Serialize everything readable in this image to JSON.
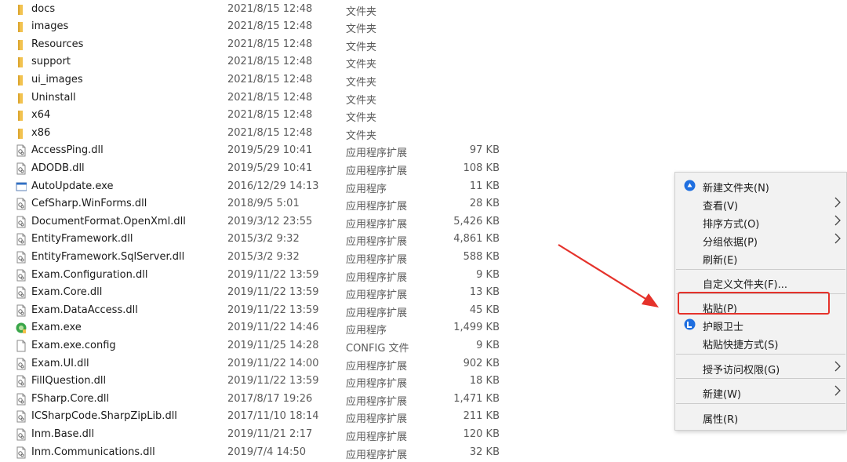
{
  "files": [
    {
      "name": "docs",
      "date": "2021/8/15 12:48",
      "type": "文件夹",
      "size": "",
      "icon": "folder-icon"
    },
    {
      "name": "images",
      "date": "2021/8/15 12:48",
      "type": "文件夹",
      "size": "",
      "icon": "folder-icon"
    },
    {
      "name": "Resources",
      "date": "2021/8/15 12:48",
      "type": "文件夹",
      "size": "",
      "icon": "folder-icon"
    },
    {
      "name": "support",
      "date": "2021/8/15 12:48",
      "type": "文件夹",
      "size": "",
      "icon": "folder-icon"
    },
    {
      "name": "ui_images",
      "date": "2021/8/15 12:48",
      "type": "文件夹",
      "size": "",
      "icon": "folder-icon"
    },
    {
      "name": "Uninstall",
      "date": "2021/8/15 12:48",
      "type": "文件夹",
      "size": "",
      "icon": "folder-icon"
    },
    {
      "name": "x64",
      "date": "2021/8/15 12:48",
      "type": "文件夹",
      "size": "",
      "icon": "folder-icon"
    },
    {
      "name": "x86",
      "date": "2021/8/15 12:48",
      "type": "文件夹",
      "size": "",
      "icon": "folder-icon"
    },
    {
      "name": "AccessPing.dll",
      "date": "2019/5/29 10:41",
      "type": "应用程序扩展",
      "size": "97 KB",
      "icon": "dll-icon"
    },
    {
      "name": "ADODB.dll",
      "date": "2019/5/29 10:41",
      "type": "应用程序扩展",
      "size": "108 KB",
      "icon": "dll-icon"
    },
    {
      "name": "AutoUpdate.exe",
      "date": "2016/12/29 14:13",
      "type": "应用程序",
      "size": "11 KB",
      "icon": "exe-icon"
    },
    {
      "name": "CefSharp.WinForms.dll",
      "date": "2018/9/5 5:01",
      "type": "应用程序扩展",
      "size": "28 KB",
      "icon": "dll-icon"
    },
    {
      "name": "DocumentFormat.OpenXml.dll",
      "date": "2019/3/12 23:55",
      "type": "应用程序扩展",
      "size": "5,426 KB",
      "icon": "dll-icon"
    },
    {
      "name": "EntityFramework.dll",
      "date": "2015/3/2 9:32",
      "type": "应用程序扩展",
      "size": "4,861 KB",
      "icon": "dll-icon"
    },
    {
      "name": "EntityFramework.SqlServer.dll",
      "date": "2015/3/2 9:32",
      "type": "应用程序扩展",
      "size": "588 KB",
      "icon": "dll-icon"
    },
    {
      "name": "Exam.Configuration.dll",
      "date": "2019/11/22 13:59",
      "type": "应用程序扩展",
      "size": "9 KB",
      "icon": "dll-icon"
    },
    {
      "name": "Exam.Core.dll",
      "date": "2019/11/22 13:59",
      "type": "应用程序扩展",
      "size": "13 KB",
      "icon": "dll-icon"
    },
    {
      "name": "Exam.DataAccess.dll",
      "date": "2019/11/22 13:59",
      "type": "应用程序扩展",
      "size": "45 KB",
      "icon": "dll-icon"
    },
    {
      "name": "Exam.exe",
      "date": "2019/11/22 14:46",
      "type": "应用程序",
      "size": "1,499 KB",
      "icon": "app-green-icon"
    },
    {
      "name": "Exam.exe.config",
      "date": "2019/11/25 14:28",
      "type": "CONFIG 文件",
      "size": "9 KB",
      "icon": "file-icon"
    },
    {
      "name": "Exam.UI.dll",
      "date": "2019/11/22 14:00",
      "type": "应用程序扩展",
      "size": "902 KB",
      "icon": "dll-icon"
    },
    {
      "name": "FillQuestion.dll",
      "date": "2019/11/22 13:59",
      "type": "应用程序扩展",
      "size": "18 KB",
      "icon": "dll-icon"
    },
    {
      "name": "FSharp.Core.dll",
      "date": "2017/8/17 19:26",
      "type": "应用程序扩展",
      "size": "1,471 KB",
      "icon": "dll-icon"
    },
    {
      "name": "ICSharpCode.SharpZipLib.dll",
      "date": "2017/11/10 18:14",
      "type": "应用程序扩展",
      "size": "211 KB",
      "icon": "dll-icon"
    },
    {
      "name": "Inm.Base.dll",
      "date": "2019/11/21 2:17",
      "type": "应用程序扩展",
      "size": "120 KB",
      "icon": "dll-icon"
    },
    {
      "name": "Inm.Communications.dll",
      "date": "2019/7/4 14:50",
      "type": "应用程序扩展",
      "size": "32 KB",
      "icon": "dll-icon"
    }
  ],
  "context_menu": {
    "items": [
      {
        "label": "新建文件夹(N)",
        "icon": "new-folder-icon",
        "submenu": false
      },
      {
        "label": "查看(V)",
        "icon": "",
        "submenu": true
      },
      {
        "label": "排序方式(O)",
        "icon": "",
        "submenu": true
      },
      {
        "label": "分组依据(P)",
        "icon": "",
        "submenu": true
      },
      {
        "label": "刷新(E)",
        "icon": "",
        "submenu": false
      },
      {
        "label": "自定义文件夹(F)...",
        "icon": "",
        "submenu": false
      },
      {
        "label": "粘贴(P)",
        "icon": "",
        "submenu": false
      },
      {
        "label": "护眼卫士",
        "icon": "eye-guard-icon",
        "submenu": false
      },
      {
        "label": "粘贴快捷方式(S)",
        "icon": "",
        "submenu": false
      },
      {
        "label": "授予访问权限(G)",
        "icon": "",
        "submenu": true
      },
      {
        "label": "新建(W)",
        "icon": "",
        "submenu": true
      },
      {
        "label": "属性(R)",
        "icon": "",
        "submenu": false
      }
    ]
  },
  "colors": {
    "folder": "#f2c24f",
    "annotation_red": "#e5322b",
    "menu_bg": "#f2f2f2",
    "icon_blue": "#1f6fe0"
  }
}
